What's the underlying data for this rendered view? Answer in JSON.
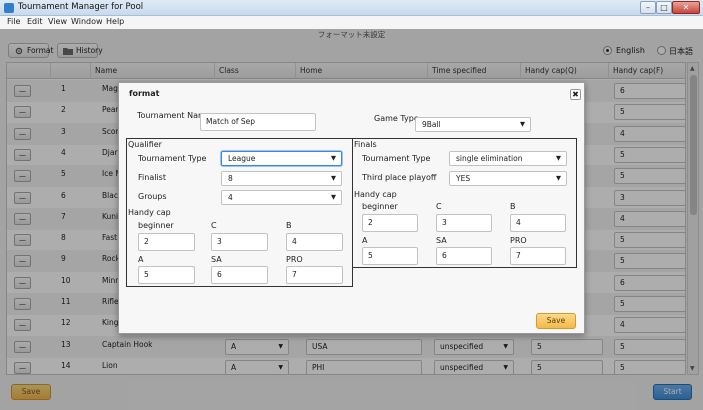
{
  "window": {
    "title": "Tournament Manager for Pool"
  },
  "menu": [
    "File",
    "Edit",
    "View",
    "Window",
    "Help"
  ],
  "status_text": "フォーマット未設定",
  "toolbar": {
    "format_label": "Format",
    "history_label": "History"
  },
  "language": {
    "english": "English",
    "japanese": "日本語",
    "selected": "English"
  },
  "table": {
    "columns": [
      "Name",
      "Class",
      "Home",
      "Time specified",
      "Handy cap(Q)",
      "Handy cap(F)"
    ],
    "rows": [
      {
        "num": "1",
        "name": "Mag",
        "handy_f": "6"
      },
      {
        "num": "2",
        "name": "Pear",
        "handy_f": "5"
      },
      {
        "num": "3",
        "name": "Scor",
        "handy_f": "4"
      },
      {
        "num": "4",
        "name": "Djar",
        "handy_f": "5"
      },
      {
        "num": "5",
        "name": "Ice M",
        "handy_f": "5"
      },
      {
        "num": "6",
        "name": "Black",
        "handy_f": "3"
      },
      {
        "num": "7",
        "name": "Kuni",
        "handy_f": "4"
      },
      {
        "num": "8",
        "name": "Fast",
        "handy_f": "5"
      },
      {
        "num": "9",
        "name": "Rock",
        "handy_f": "5"
      },
      {
        "num": "10",
        "name": "Minn",
        "handy_f": "6"
      },
      {
        "num": "11",
        "name": "Rifle",
        "handy_f": "5"
      },
      {
        "num": "12",
        "name": "King",
        "handy_f": "4"
      },
      {
        "num": "13",
        "name": "Captain Hook",
        "class": "A",
        "home": "USA",
        "time": "unspecified",
        "handy_q": "5",
        "handy_f": "5"
      },
      {
        "num": "14",
        "name": "Lion",
        "class": "A",
        "home": "PHI",
        "time": "unspecified",
        "handy_q": "5",
        "handy_f": "5"
      }
    ],
    "remove_label": "—"
  },
  "footer": {
    "save_label": "Save",
    "start_label": "Start"
  },
  "dialog": {
    "title": "format",
    "close_label": "✖",
    "tournament_name_label": "Tournament Name",
    "tournament_name_value": "Match of Sep",
    "game_type_label": "Game Type",
    "game_type_value": "9Ball",
    "qualifier": {
      "heading": "Qualifier",
      "tournament_type_label": "Tournament Type",
      "tournament_type_value": "League",
      "finalist_label": "Finalist",
      "finalist_value": "8",
      "groups_label": "Groups",
      "groups_value": "4",
      "handy_cap_label": "Handy cap",
      "beginner_label": "beginner",
      "beginner_value": "2",
      "c_label": "C",
      "c_value": "3",
      "b_label": "B",
      "b_value": "4",
      "a_label": "A",
      "a_value": "5",
      "sa_label": "SA",
      "sa_value": "6",
      "pro_label": "PRO",
      "pro_value": "7"
    },
    "finals": {
      "heading": "Finals",
      "tournament_type_label": "Tournament Type",
      "tournament_type_value": "single elimination",
      "third_place_label": "Third place playoff",
      "third_place_value": "YES",
      "handy_cap_label": "Handy cap",
      "beginner_label": "beginner",
      "beginner_value": "2",
      "c_label": "C",
      "c_value": "3",
      "b_label": "B",
      "b_value": "4",
      "a_label": "A",
      "a_value": "5",
      "sa_label": "SA",
      "sa_value": "6",
      "pro_label": "PRO",
      "pro_value": "7"
    },
    "save_label": "Save"
  }
}
